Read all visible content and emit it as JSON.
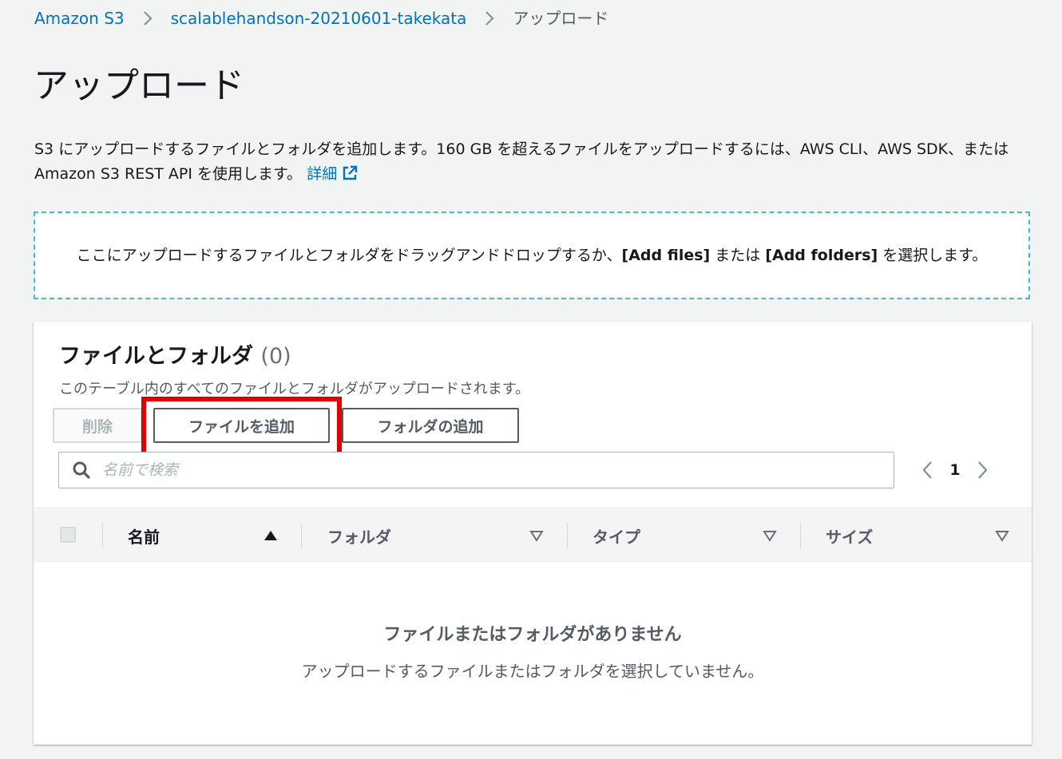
{
  "breadcrumb": {
    "items": [
      {
        "label": "Amazon S3"
      },
      {
        "label": "scalablehandson-20210601-takekata"
      },
      {
        "label": "アップロード"
      }
    ]
  },
  "page": {
    "title": "アップロード",
    "description_text": "S3 にアップロードするファイルとフォルダを追加します。160 GB を超えるファイルをアップロードするには、AWS CLI、AWS SDK、または Amazon S3 REST API を使用します。",
    "learn_more_label": "詳細"
  },
  "dropzone": {
    "text_part1": "ここにアップロードするファイルとフォルダをドラッグアンドドロップするか、",
    "add_files_label": "[Add files]",
    "text_part2": " または ",
    "add_folders_label": "[Add folders]",
    "text_part3": " を選択します。"
  },
  "files_panel": {
    "title": "ファイルとフォルダ",
    "count": "(0)",
    "description": "このテーブル内のすべてのファイルとフォルダがアップロードされます。",
    "delete_label": "削除",
    "add_files_label": "ファイルを追加",
    "add_folder_label": "フォルダの追加",
    "search_placeholder": "名前で検索",
    "current_page": "1",
    "columns": [
      {
        "label": "名前",
        "sort": "ascending"
      },
      {
        "label": "フォルダ",
        "sort": "none"
      },
      {
        "label": "タイプ",
        "sort": "none"
      },
      {
        "label": "サイズ",
        "sort": "none"
      }
    ],
    "empty_title": "ファイルまたはフォルダがありません",
    "empty_description": "アップロードするファイルまたはフォルダを選択していません。"
  },
  "colors": {
    "link": "#0073bb",
    "highlight": "#e10000",
    "dropzone_border": "#44b9d6"
  }
}
